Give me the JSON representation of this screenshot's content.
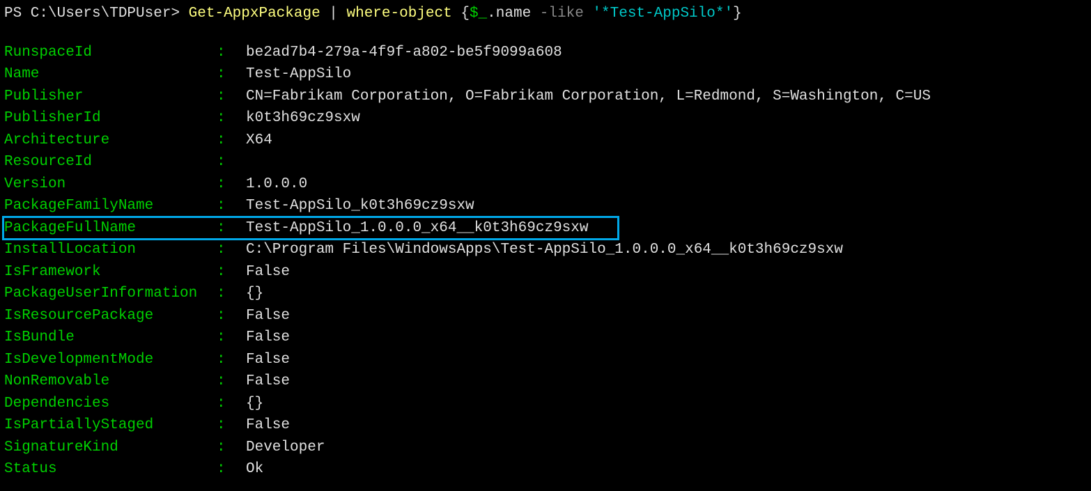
{
  "prompt": {
    "prefix": "PS C:\\Users\\TDPUser> ",
    "cmd1": "Get-AppxPackage",
    "pipe": " | ",
    "cmd2": "where-object",
    "space": " ",
    "brace_open": "{",
    "var": "$_",
    "dot_name": ".name ",
    "like": "-like ",
    "arg": "'*Test-AppSilo*'",
    "brace_close": "}"
  },
  "rows": [
    {
      "key": "RunspaceId",
      "value": "be2ad7b4-279a-4f9f-a802-be5f9099a608"
    },
    {
      "key": "Name",
      "value": "Test-AppSilo"
    },
    {
      "key": "Publisher",
      "value": "CN=Fabrikam Corporation, O=Fabrikam Corporation, L=Redmond, S=Washington, C=US"
    },
    {
      "key": "PublisherId",
      "value": "k0t3h69cz9sxw"
    },
    {
      "key": "Architecture",
      "value": "X64"
    },
    {
      "key": "ResourceId",
      "value": ""
    },
    {
      "key": "Version",
      "value": "1.0.0.0"
    },
    {
      "key": "PackageFamilyName",
      "value": "Test-AppSilo_k0t3h69cz9sxw"
    },
    {
      "key": "PackageFullName",
      "value": "Test-AppSilo_1.0.0.0_x64__k0t3h69cz9sxw",
      "highlight": true
    },
    {
      "key": "InstallLocation",
      "value": "C:\\Program Files\\WindowsApps\\Test-AppSilo_1.0.0.0_x64__k0t3h69cz9sxw"
    },
    {
      "key": "IsFramework",
      "value": "False"
    },
    {
      "key": "PackageUserInformation",
      "value": "{}"
    },
    {
      "key": "IsResourcePackage",
      "value": "False"
    },
    {
      "key": "IsBundle",
      "value": "False"
    },
    {
      "key": "IsDevelopmentMode",
      "value": "False"
    },
    {
      "key": "NonRemovable",
      "value": "False"
    },
    {
      "key": "Dependencies",
      "value": "{}"
    },
    {
      "key": "IsPartiallyStaged",
      "value": "False"
    },
    {
      "key": "SignatureKind",
      "value": "Developer"
    },
    {
      "key": "Status",
      "value": "Ok"
    }
  ]
}
